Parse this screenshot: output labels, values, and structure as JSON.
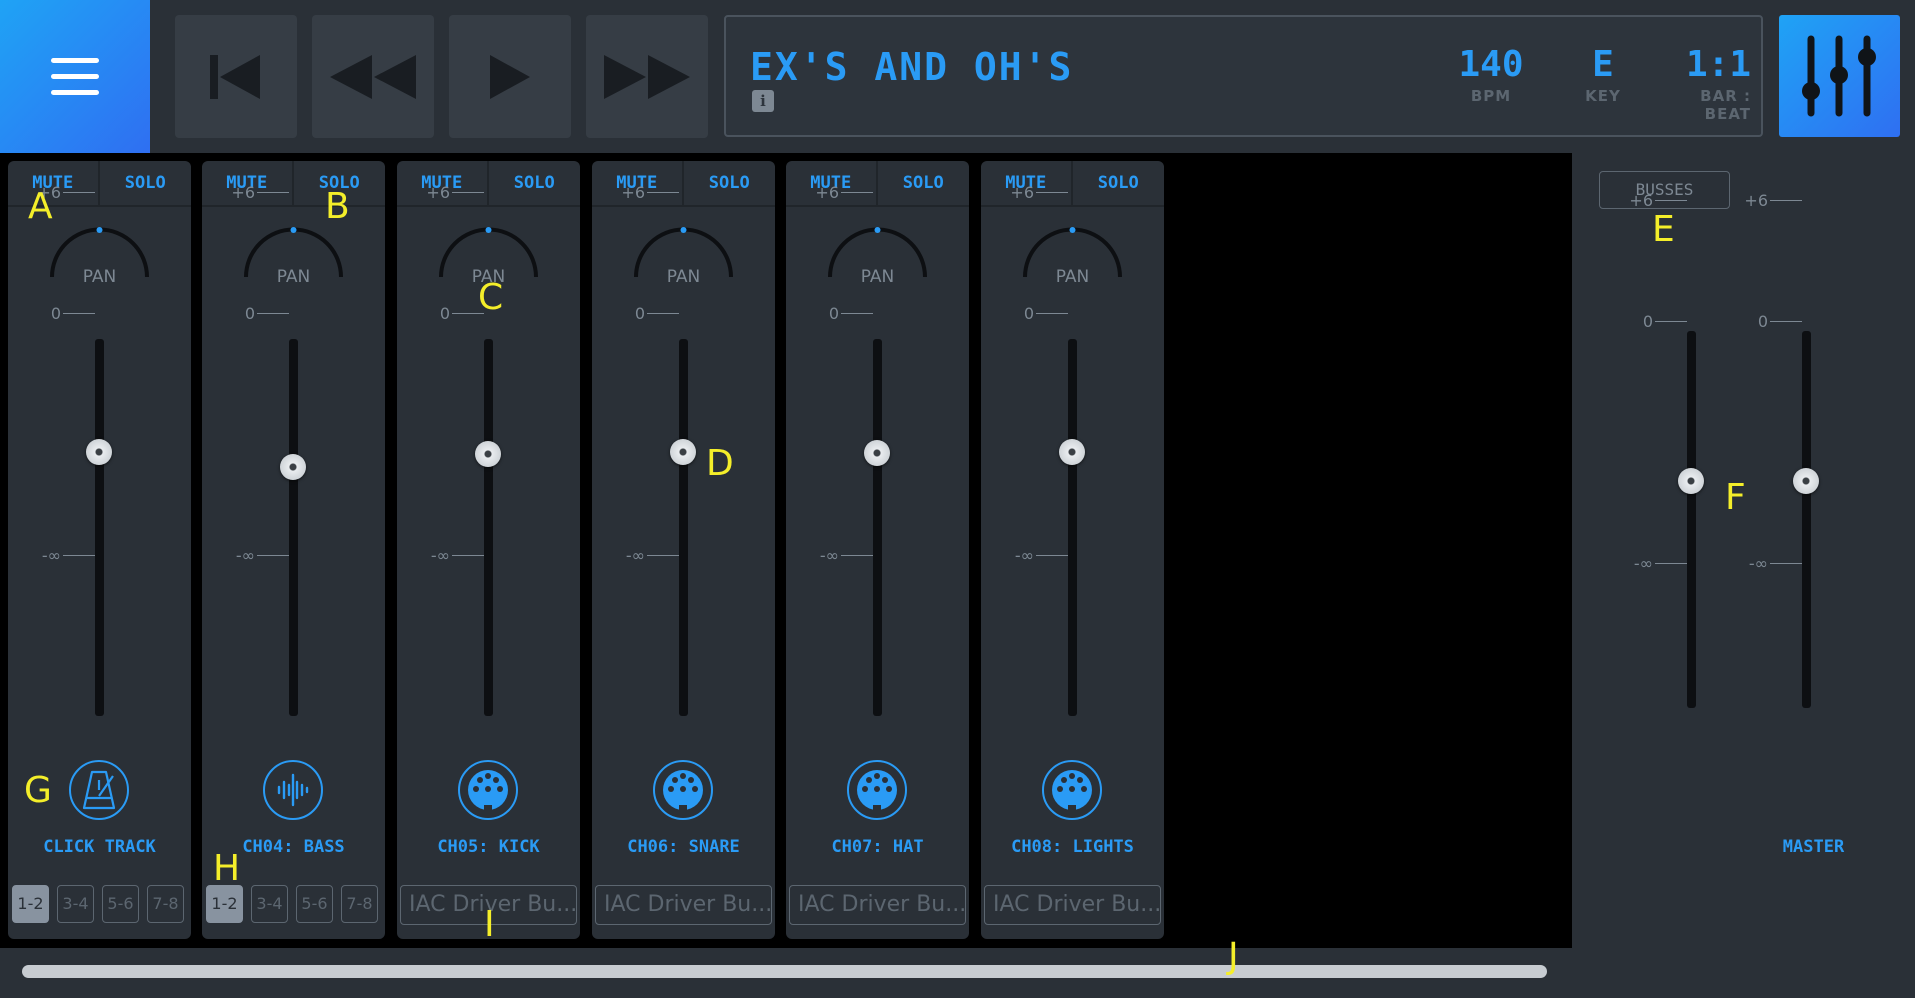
{
  "header": {
    "song_title": "EX'S AND OH'S",
    "info": "i",
    "bpm_value": "140",
    "bpm_label": "BPM",
    "key_value": "E",
    "key_label": "KEY",
    "beat_value": "1:1",
    "beat_label": "BAR : BEAT"
  },
  "strip_labels": {
    "mute": "MUTE",
    "solo": "SOLO",
    "pan": "PAN",
    "tick_top": "+6",
    "tick_zero": "0",
    "tick_bottom": "-∞"
  },
  "channels": [
    {
      "name": "CLICK TRACK",
      "icon": "metronome-icon",
      "outputs": [
        "1-2",
        "3-4",
        "5-6",
        "7-8"
      ],
      "selected_output": "1-2"
    },
    {
      "name": "CH04: BASS",
      "icon": "waveform-icon",
      "outputs": [
        "1-2",
        "3-4",
        "5-6",
        "7-8"
      ],
      "selected_output": "1-2"
    },
    {
      "name": "CH05: KICK",
      "icon": "midi-icon",
      "midi_output": "IAC Driver Bu..."
    },
    {
      "name": "CH06: SNARE",
      "icon": "midi-icon",
      "midi_output": "IAC Driver Bu..."
    },
    {
      "name": "CH07: HAT",
      "icon": "midi-icon",
      "midi_output": "IAC Driver Bu..."
    },
    {
      "name": "CH08: LIGHTS",
      "icon": "midi-icon",
      "midi_output": "IAC Driver Bu..."
    }
  ],
  "master": {
    "busses_label": "BUSSES",
    "name": "MASTER"
  },
  "annotations": {
    "a": "A",
    "b": "B",
    "c": "C",
    "d": "D",
    "e": "E",
    "f": "F",
    "g": "G",
    "h": "H",
    "i": "I",
    "j": "J"
  },
  "colors": {
    "accent": "#2a9bf5",
    "panel": "#2a3037",
    "annotation": "#f4ee2a"
  }
}
